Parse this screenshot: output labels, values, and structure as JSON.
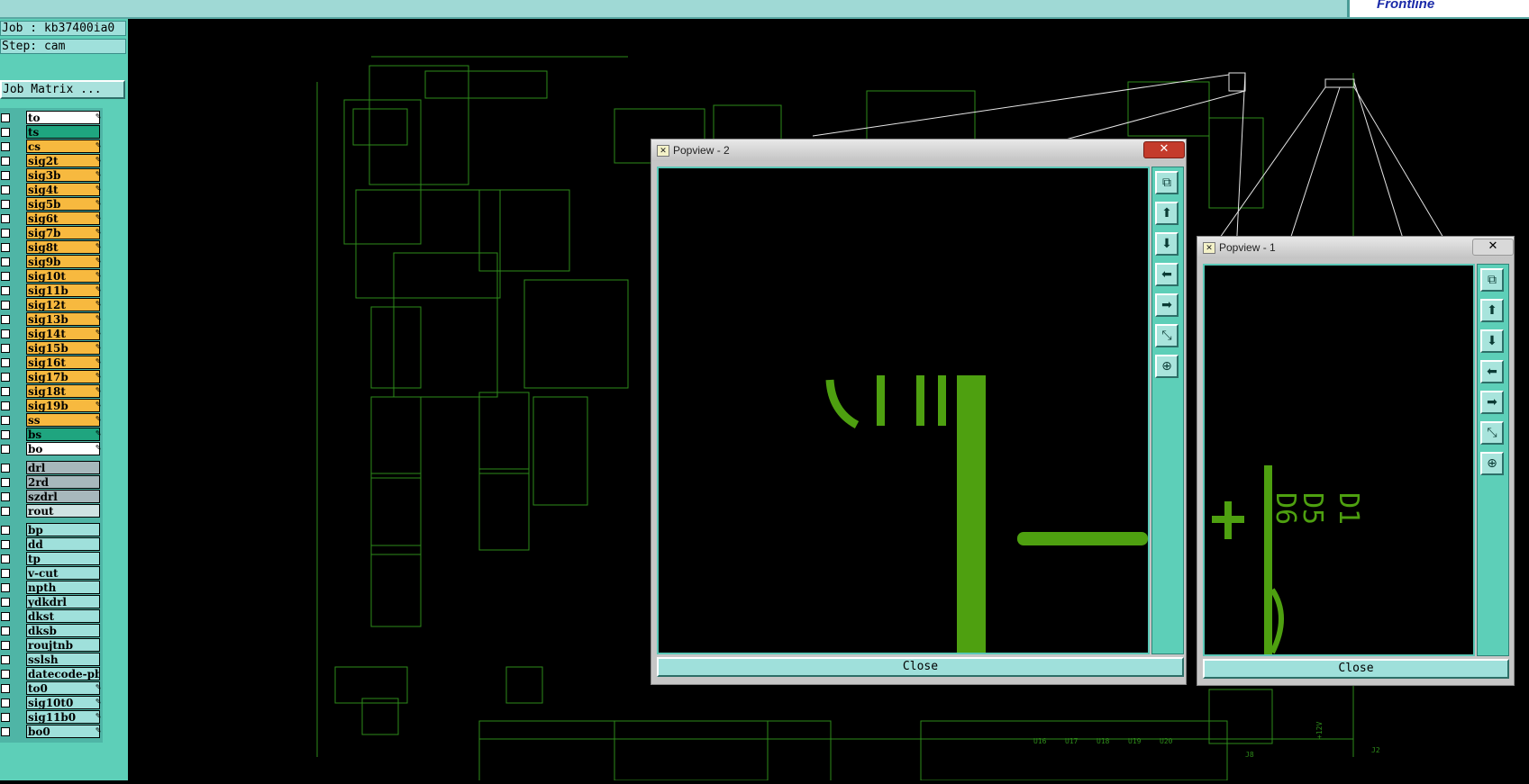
{
  "info": {
    "job": "Job : kb37400ia0",
    "step": "Step: cam",
    "job_matrix": "Job Matrix ..."
  },
  "logo": "Frontline",
  "layers": [
    {
      "name": "to",
      "color": "#ffffff",
      "pen": true
    },
    {
      "name": "ts",
      "color": "#1fa57f",
      "pen": false
    },
    {
      "name": "cs",
      "color": "#f7b93f",
      "pen": true
    },
    {
      "name": "sig2t",
      "color": "#f7b93f",
      "pen": true
    },
    {
      "name": "sig3b",
      "color": "#f7b93f",
      "pen": true
    },
    {
      "name": "sig4t",
      "color": "#f7b93f",
      "pen": true
    },
    {
      "name": "sig5b",
      "color": "#f7b93f",
      "pen": true
    },
    {
      "name": "sig6t",
      "color": "#f7b93f",
      "pen": true
    },
    {
      "name": "sig7b",
      "color": "#f7b93f",
      "pen": true
    },
    {
      "name": "sig8t",
      "color": "#f7b93f",
      "pen": true
    },
    {
      "name": "sig9b",
      "color": "#f7b93f",
      "pen": true
    },
    {
      "name": "sig10t",
      "color": "#f7b93f",
      "pen": true
    },
    {
      "name": "sig11b",
      "color": "#f7b93f",
      "pen": true
    },
    {
      "name": "sig12t",
      "color": "#f7b93f",
      "pen": true
    },
    {
      "name": "sig13b",
      "color": "#f7b93f",
      "pen": true
    },
    {
      "name": "sig14t",
      "color": "#f7b93f",
      "pen": true
    },
    {
      "name": "sig15b",
      "color": "#f7b93f",
      "pen": true
    },
    {
      "name": "sig16t",
      "color": "#f7b93f",
      "pen": true
    },
    {
      "name": "sig17b",
      "color": "#f7b93f",
      "pen": true
    },
    {
      "name": "sig18t",
      "color": "#f7b93f",
      "pen": true
    },
    {
      "name": "sig19b",
      "color": "#f7b93f",
      "pen": true
    },
    {
      "name": "ss",
      "color": "#f7b93f",
      "pen": true
    },
    {
      "name": "bs",
      "color": "#1fa57f",
      "pen": true
    },
    {
      "name": "bo",
      "color": "#ffffff",
      "pen": true
    },
    {
      "name": "drl",
      "color": "#a7b8bc",
      "pen": false
    },
    {
      "name": "2rd",
      "color": "#a7b8bc",
      "pen": false
    },
    {
      "name": "szdrl",
      "color": "#a7b8bc",
      "pen": false
    },
    {
      "name": "rout",
      "color": "#cfe3e3",
      "pen": false
    },
    {
      "name": "bp",
      "color": "#9fe0db",
      "pen": false
    },
    {
      "name": "dd",
      "color": "#9fe0db",
      "pen": false
    },
    {
      "name": "tp",
      "color": "#9fe0db",
      "pen": false
    },
    {
      "name": "v-cut",
      "color": "#9fe0db",
      "pen": false
    },
    {
      "name": "npth",
      "color": "#9fe0db",
      "pen": false
    },
    {
      "name": "ydkdrl",
      "color": "#9fe0db",
      "pen": false
    },
    {
      "name": "dkst",
      "color": "#9fe0db",
      "pen": false
    },
    {
      "name": "dksb",
      "color": "#9fe0db",
      "pen": false
    },
    {
      "name": "roujtnb",
      "color": "#9fe0db",
      "pen": false
    },
    {
      "name": "sslsh",
      "color": "#9fe0db",
      "pen": false
    },
    {
      "name": "datecode-pbo",
      "color": "#9fe0db",
      "pen": false
    },
    {
      "name": "to0",
      "color": "#9fe0db",
      "pen": true
    },
    {
      "name": "sig10t0",
      "color": "#9fe0db",
      "pen": true
    },
    {
      "name": "sig11b0",
      "color": "#9fe0db",
      "pen": true
    },
    {
      "name": "bo0",
      "color": "#9fe0db",
      "pen": true
    }
  ],
  "popview2": {
    "title": "Popview - 2",
    "close": "Close"
  },
  "popview1": {
    "title": "Popview - 1",
    "close": "Close"
  },
  "tool_icons": [
    "zoom-fit-icon",
    "pan-up-icon",
    "pan-down-icon",
    "pan-left-icon",
    "pan-right-icon",
    "zoom-out-icon",
    "zoom-in-icon"
  ],
  "pcb_labels": [
    "+12V",
    "J8",
    "J2",
    "U16",
    "U17",
    "U18",
    "U19",
    "U20"
  ]
}
